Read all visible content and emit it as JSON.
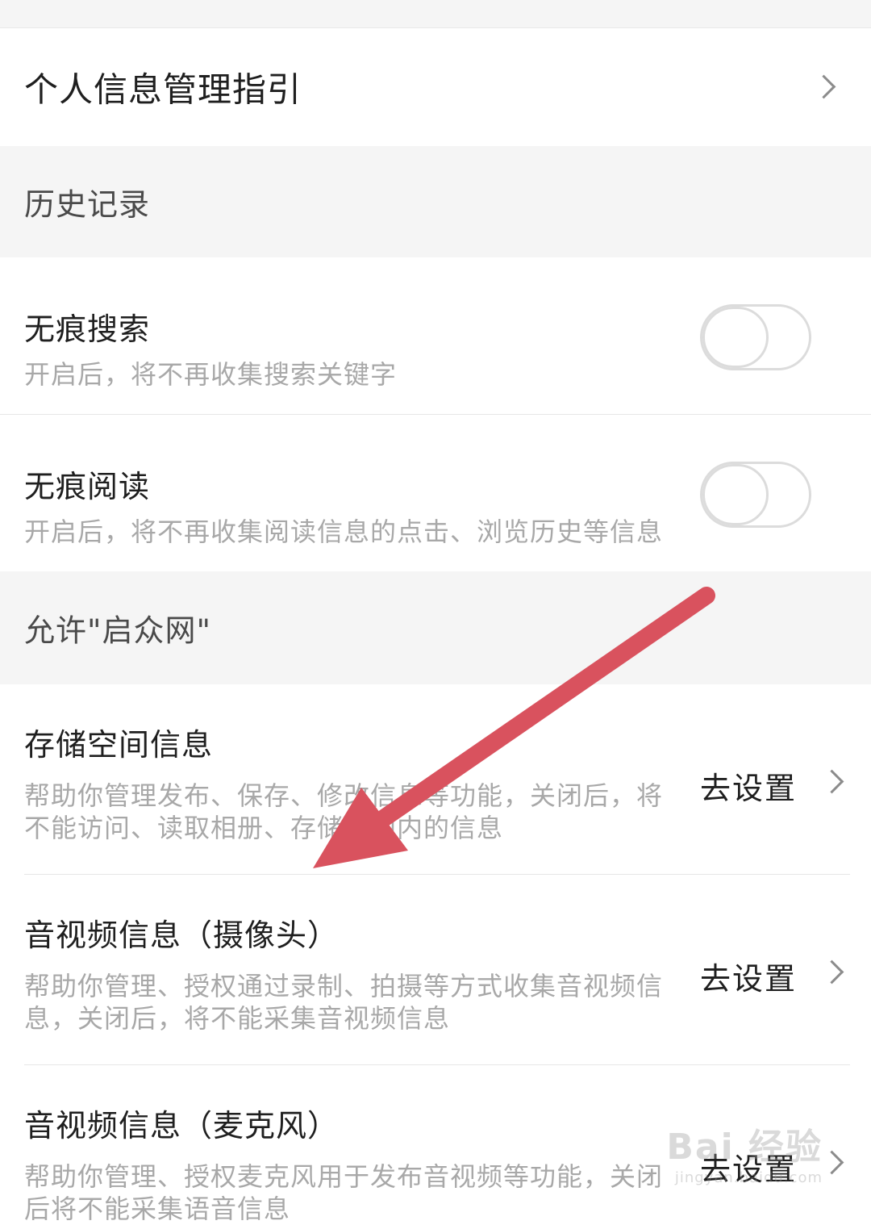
{
  "guide_row": {
    "title": "个人信息管理指引"
  },
  "sections": {
    "history_header": "历史记录",
    "permissions_header": "允许\"启众网\""
  },
  "toggles": [
    {
      "title": "无痕搜索",
      "desc": "开启后，将不再收集搜索关键字",
      "enabled": false
    },
    {
      "title": "无痕阅读",
      "desc": "开启后，将不再收集阅读信息的点击、浏览历史等信息",
      "enabled": false
    }
  ],
  "permissions": [
    {
      "title": "存储空间信息",
      "desc": "帮助你管理发布、保存、修改信息等功能，关闭后，将不能访问、读取相册、存储空间内的信息",
      "action": "去设置"
    },
    {
      "title": "音视频信息（摄像头）",
      "desc": "帮助你管理、授权通过录制、拍摄等方式收集音视频信息，关闭后，将不能采集音视频信息",
      "action": "去设置"
    },
    {
      "title": "音视频信息（麦克风）",
      "desc": "帮助你管理、授权麦克风用于发布音视频等功能，关闭后将不能采集语音信息",
      "action": "去设置"
    }
  ],
  "annotation": {
    "color": "#d9525e"
  },
  "watermark": {
    "main": "Bai 经验",
    "sub": "jingyan.baidu.com"
  }
}
